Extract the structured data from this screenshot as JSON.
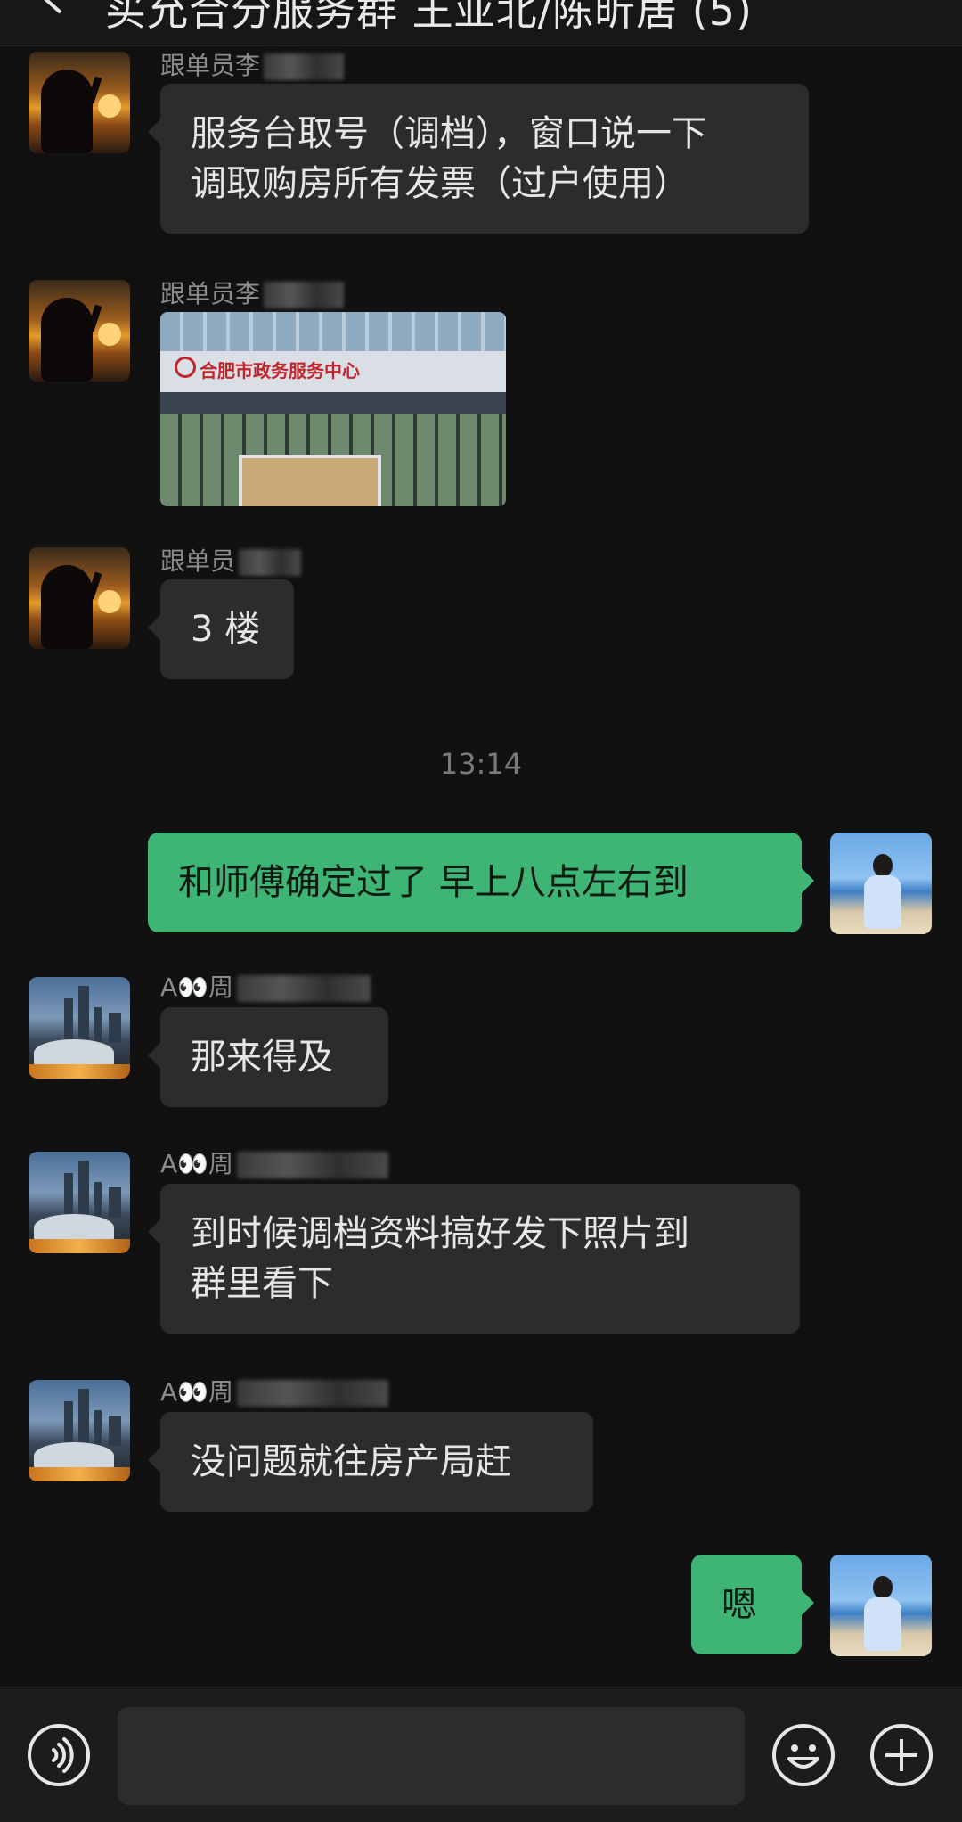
{
  "header": {
    "title": "买允合分服务群 王亚北/陈昕居 (5)"
  },
  "messages": [
    {
      "side": "left",
      "avatar": "sunset-silhouette-avatar",
      "sender": "跟单员李",
      "text_lines": [
        "服务台取号（调档），窗口说一下",
        "调取购房所有发票（过户使用）"
      ]
    },
    {
      "side": "left",
      "avatar": "sunset-silhouette-avatar",
      "sender": "跟单员李",
      "type": "image",
      "image_caption": "合肥市政务服务中心"
    },
    {
      "side": "left",
      "avatar": "sunset-silhouette-avatar",
      "sender": "跟单员",
      "text": "3 楼"
    },
    {
      "timestamp": "13:14"
    },
    {
      "side": "right",
      "avatar": "beach-girl-avatar",
      "text": "和师傅确定过了 早上八点左右到"
    },
    {
      "side": "left",
      "avatar": "city-skyline-avatar",
      "sender": "A👀周",
      "text": "那来得及"
    },
    {
      "side": "left",
      "avatar": "city-skyline-avatar",
      "sender": "A👀周",
      "text_lines": [
        "到时候调档资料搞好发下照片到",
        "群里看下"
      ]
    },
    {
      "side": "left",
      "avatar": "city-skyline-avatar",
      "sender": "A👀周",
      "text": "没问题就往房产局赶"
    },
    {
      "side": "right",
      "avatar": "beach-girl-avatar",
      "text": "嗯"
    }
  ],
  "input": {
    "value": "",
    "placeholder": ""
  },
  "icons": {
    "voice": "voice-icon",
    "emoji": "emoji-icon",
    "plus": "plus-icon",
    "back": "back-arrow-icon"
  },
  "colors": {
    "background": "#111111",
    "bubble_in": "#2c2c2c",
    "bubble_out": "#3eb575"
  }
}
